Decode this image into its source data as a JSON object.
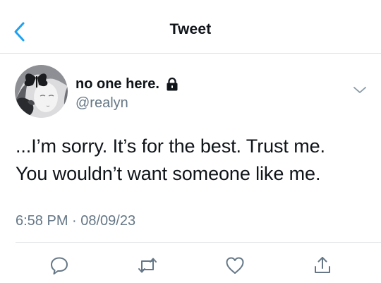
{
  "header": {
    "title": "Tweet",
    "back_icon": "chevron-left-icon"
  },
  "tweet": {
    "author": {
      "display_name": "no one here.",
      "handle": "@realyn",
      "protected_icon": "lock-icon",
      "avatar": "avatar"
    },
    "text_lines": [
      "...I’m sorry. It’s for the best. Trust me.",
      "You wouldn’t want someone like me."
    ],
    "timestamp": "6:58 PM · 08/09/23",
    "menu_icon": "chevron-down-icon"
  },
  "actions": [
    {
      "name": "reply",
      "icon": "reply-icon"
    },
    {
      "name": "retweet",
      "icon": "retweet-icon"
    },
    {
      "name": "like",
      "icon": "heart-icon"
    },
    {
      "name": "share",
      "icon": "share-icon"
    }
  ],
  "colors": {
    "accent": "#1da1f2",
    "text_primary": "#0f1419",
    "text_secondary": "#657786",
    "divider": "#dfe3e6"
  }
}
